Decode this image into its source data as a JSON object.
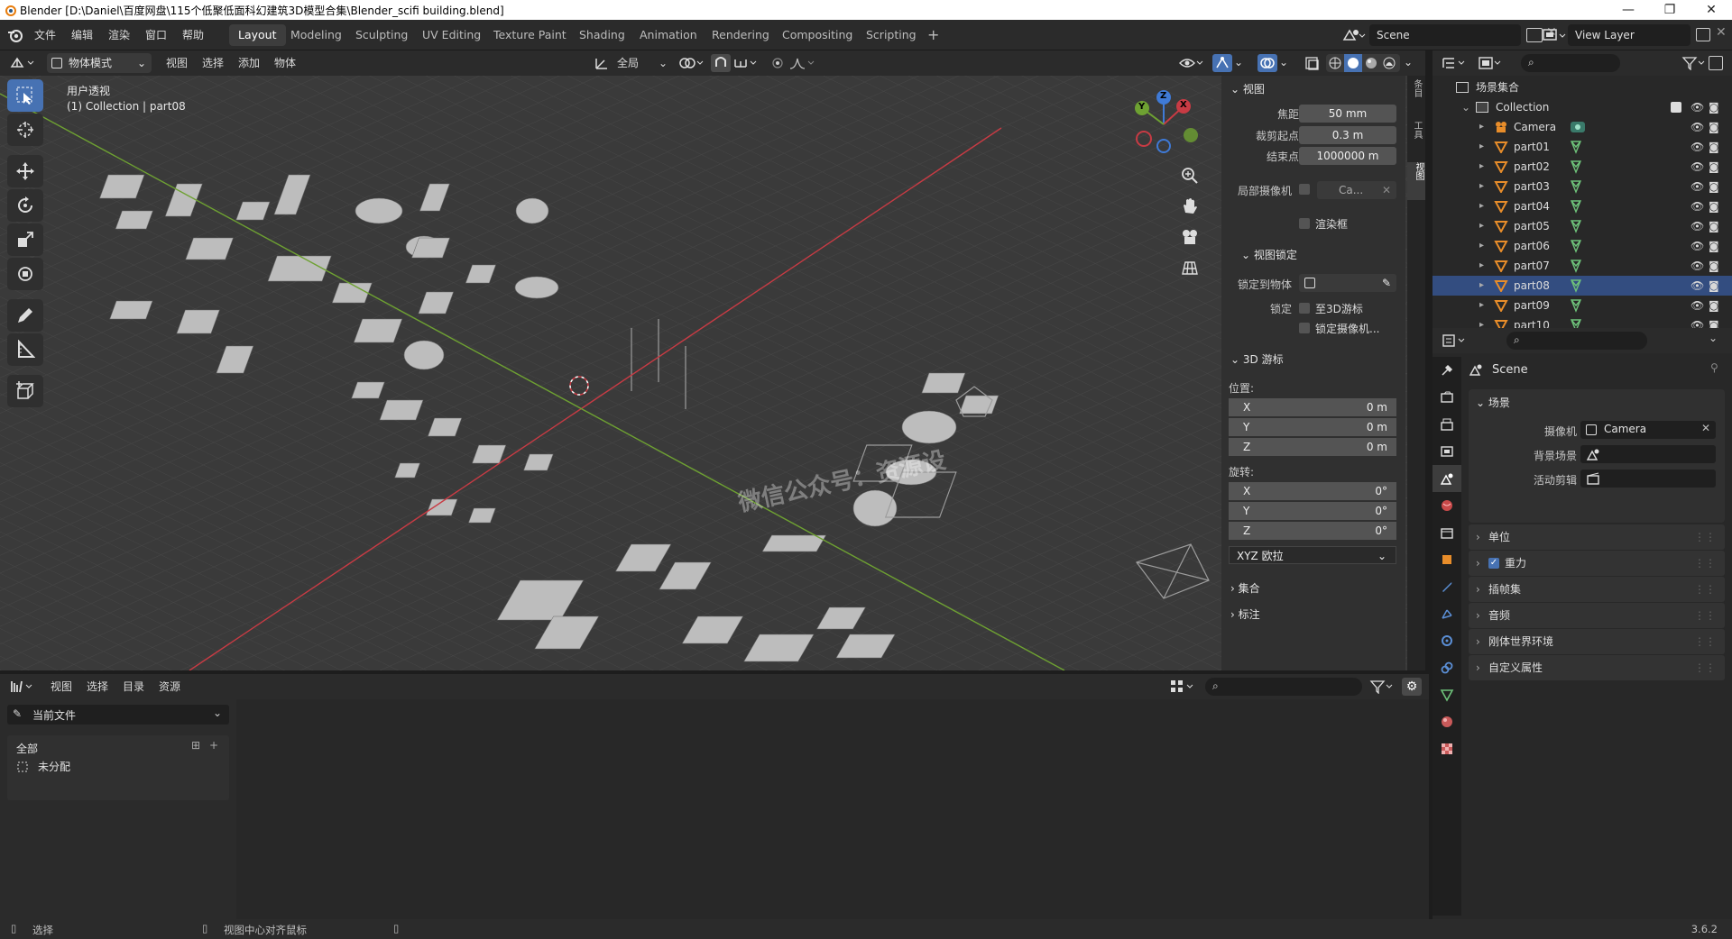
{
  "window": {
    "title": "Blender [D:\\Daniel\\百度网盘\\115个低聚低面科幻建筑3D模型合集\\Blender_scifi building.blend]",
    "buttons": [
      "—",
      "❐",
      "✕"
    ]
  },
  "menu": [
    "文件",
    "编辑",
    "渲染",
    "窗口",
    "帮助"
  ],
  "workspaces": [
    {
      "label": "Layout",
      "active": true
    },
    {
      "label": "Modeling"
    },
    {
      "label": "Sculpting"
    },
    {
      "label": "UV Editing"
    },
    {
      "label": "Texture Paint"
    },
    {
      "label": "Shading"
    },
    {
      "label": "Animation"
    },
    {
      "label": "Rendering"
    },
    {
      "label": "Compositing"
    },
    {
      "label": "Scripting"
    }
  ],
  "add_workspace": "+",
  "scene": {
    "name": "Scene",
    "view_layer": "View Layer"
  },
  "viewport_header": {
    "mode": "物体模式",
    "menus": [
      "视图",
      "选择",
      "添加",
      "物体"
    ],
    "transform_orientation": "全局"
  },
  "viewport": {
    "view_name": "用户透视",
    "context": "(1) Collection | part08",
    "watermark": "微信公众号：资源设",
    "gizmo_axes": {
      "x": "X",
      "y": "Y",
      "z": "Z"
    }
  },
  "npanel": {
    "tabs": [
      "条目",
      "工具",
      "视图"
    ],
    "view_section": "视图",
    "focal_length_label": "焦距",
    "focal_length": "50 mm",
    "clip_start_label": "裁剪起点",
    "clip_start": "0.3 m",
    "clip_end_label": "结束点",
    "clip_end": "1000000 m",
    "local_camera_label": "局部摄像机",
    "local_camera_value": "Ca...",
    "render_region": "渲染框",
    "view_lock_section": "视图锁定",
    "lock_to_object_label": "锁定到物体",
    "lock_label": "锁定",
    "lock_to_cursor": "至3D游标",
    "lock_camera": "锁定摄像机...",
    "cursor_section": "3D 游标",
    "location_label": "位置:",
    "location": [
      {
        "k": "X",
        "v": "0 m"
      },
      {
        "k": "Y",
        "v": "0 m"
      },
      {
        "k": "Z",
        "v": "0 m"
      }
    ],
    "rotation_label": "旋转:",
    "rotation": [
      {
        "k": "X",
        "v": "0°"
      },
      {
        "k": "Y",
        "v": "0°"
      },
      {
        "k": "Z",
        "v": "0°"
      }
    ],
    "rotation_mode": "XYZ 欧拉",
    "collection_section": "集合",
    "annotation_section": "标注"
  },
  "outliner": {
    "root": "场景集合",
    "collection": "Collection",
    "items": [
      "Camera",
      "part01",
      "part02",
      "part03",
      "part04",
      "part05",
      "part06",
      "part07",
      "part08",
      "part09",
      "part10"
    ],
    "selected": "part08"
  },
  "properties": {
    "context_name": "Scene",
    "section": "场景",
    "camera_label": "摄像机",
    "camera_value": "Camera",
    "background_scene_label": "背景场景",
    "active_clip_label": "活动剪辑",
    "subpanels": [
      {
        "label": "单位",
        "checkbox": false
      },
      {
        "label": "重力",
        "checkbox": true
      },
      {
        "label": "插帧集",
        "checkbox": false
      },
      {
        "label": "音频",
        "checkbox": false
      },
      {
        "label": "刚体世界环境",
        "checkbox": false
      },
      {
        "label": "自定义属性",
        "checkbox": false
      }
    ]
  },
  "asset_browser": {
    "menus": [
      "视图",
      "选择",
      "目录",
      "资源"
    ],
    "library": "当前文件",
    "catalog_all": "全部",
    "catalog_unassigned": "未分配"
  },
  "statusbar": {
    "select": "选择",
    "center_view": "视图中心对齐鼠标",
    "version": "3.6.2"
  },
  "colors": {
    "accent": "#4772b3",
    "x_axis": "#c83b44",
    "y_axis": "#6ea132",
    "z_axis": "#3f7ad6",
    "selected_row": "#334d80"
  }
}
